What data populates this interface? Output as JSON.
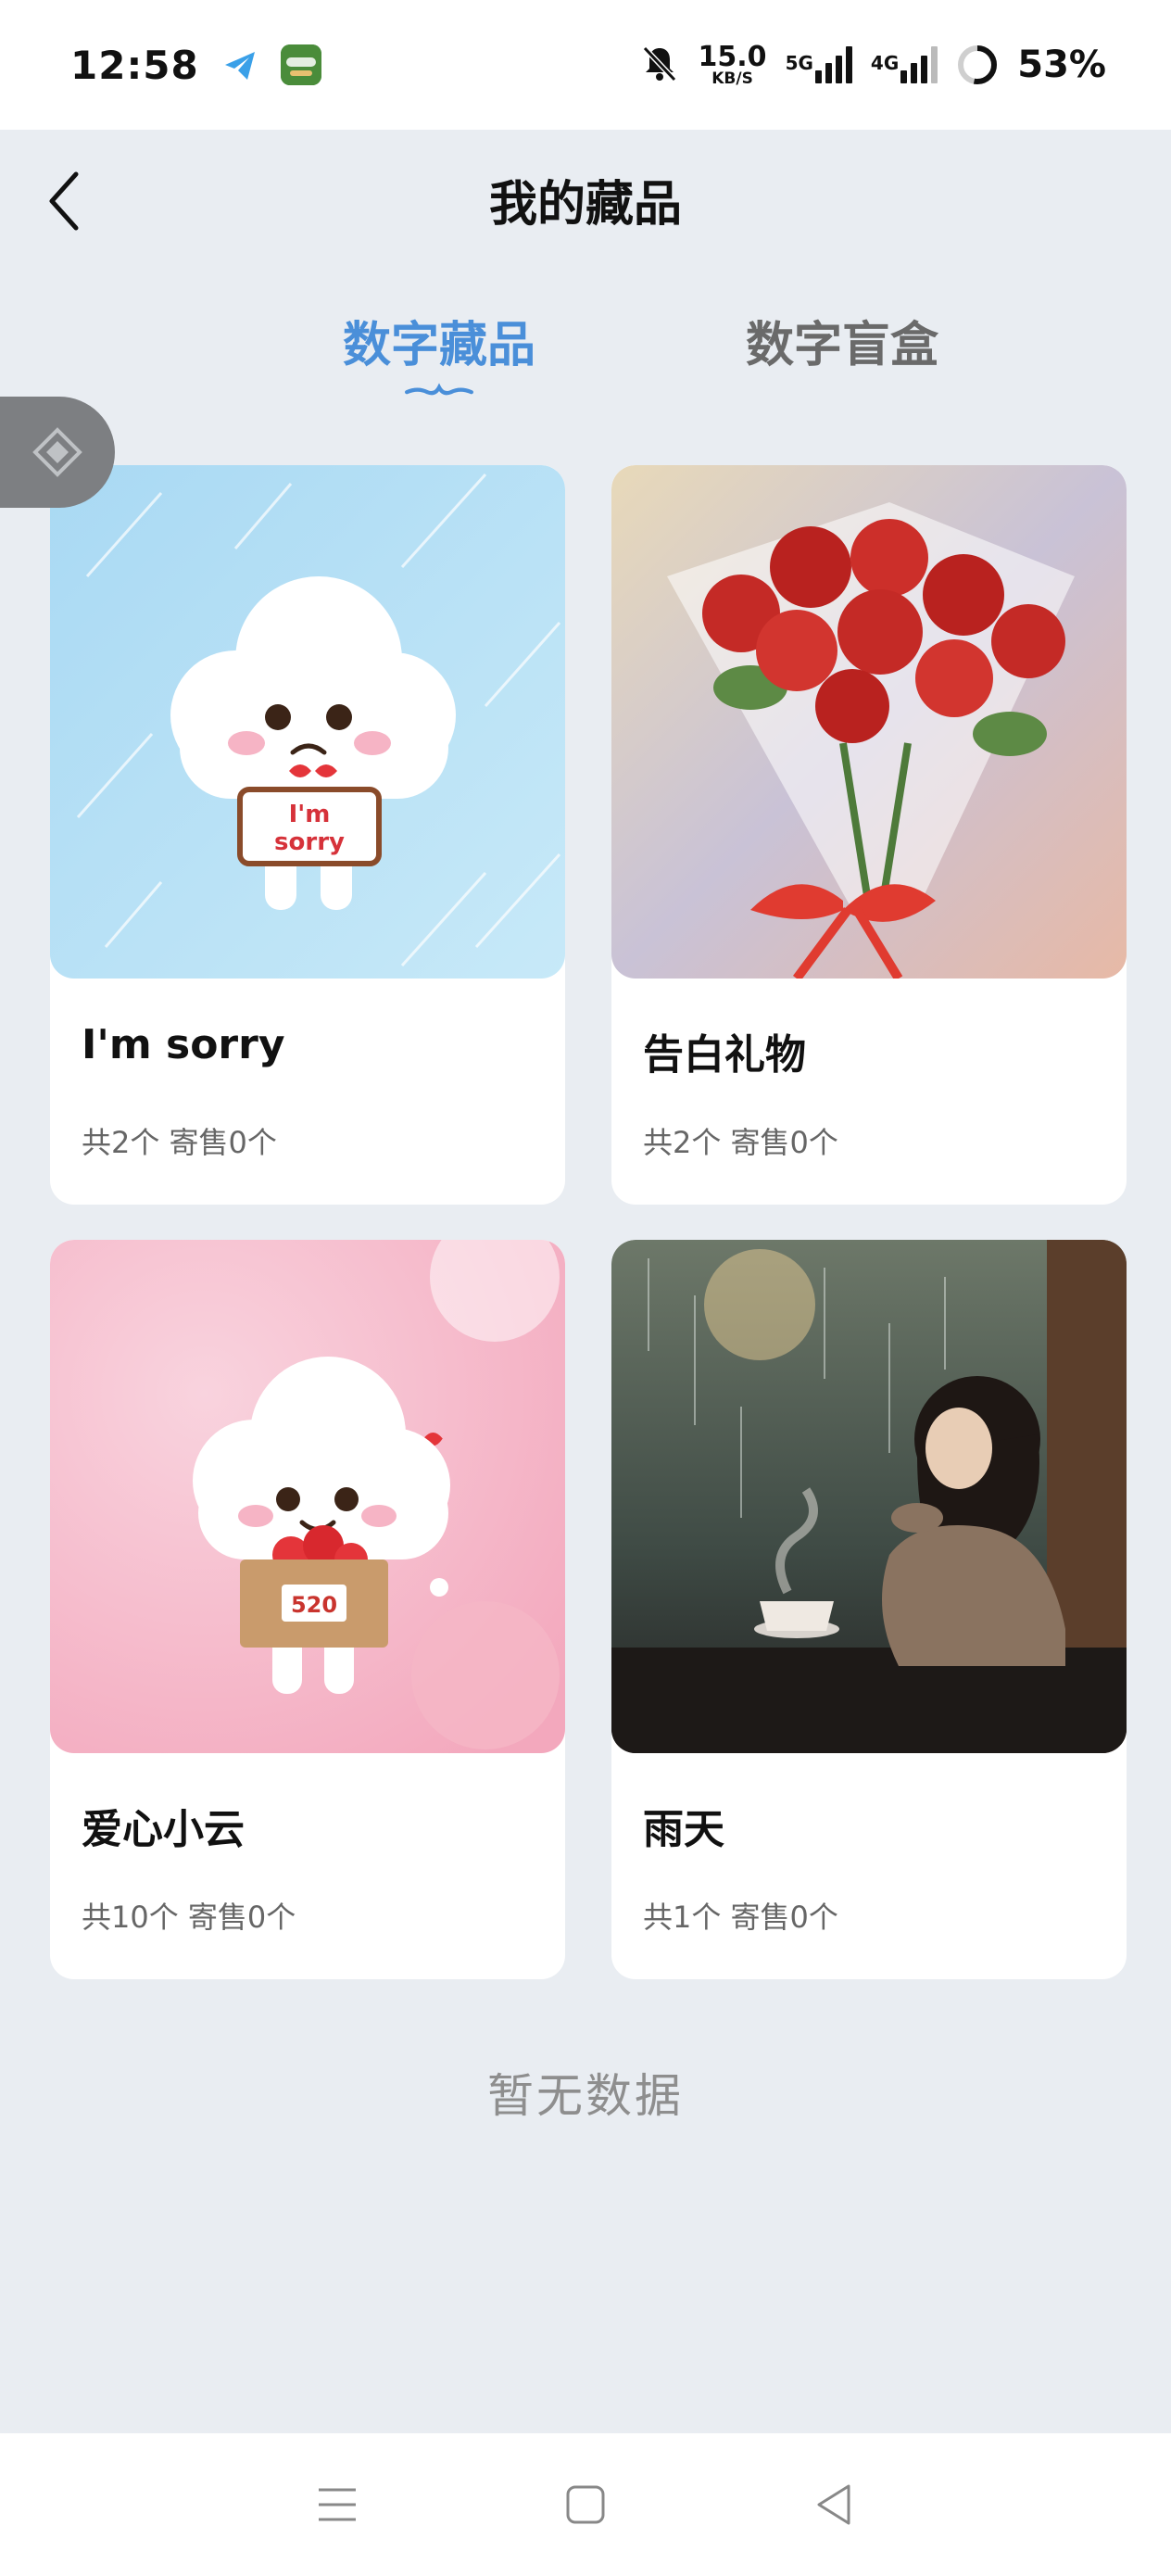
{
  "status_bar": {
    "time": "12:58",
    "speed_value": "15.0",
    "speed_unit": "KB/S",
    "network_5g": "5G",
    "network_4g": "4G",
    "battery": "53%"
  },
  "header": {
    "title": "我的藏品"
  },
  "tabs": [
    {
      "label": "数字藏品",
      "active": true
    },
    {
      "label": "数字盲盒",
      "active": false
    }
  ],
  "collection": [
    {
      "name": "I'm sorry",
      "meta": "共2个 寄售0个",
      "sign_text_1": "I'm",
      "sign_text_2": "sorry"
    },
    {
      "name": "告白礼物",
      "meta": "共2个 寄售0个"
    },
    {
      "name": "爱心小云",
      "meta": "共10个 寄售0个",
      "box_text": "520"
    },
    {
      "name": "雨天",
      "meta": "共1个 寄售0个"
    }
  ],
  "empty_state": "暂无数据",
  "colors": {
    "accent": "#4a8fd9",
    "background": "#e9edf2"
  }
}
